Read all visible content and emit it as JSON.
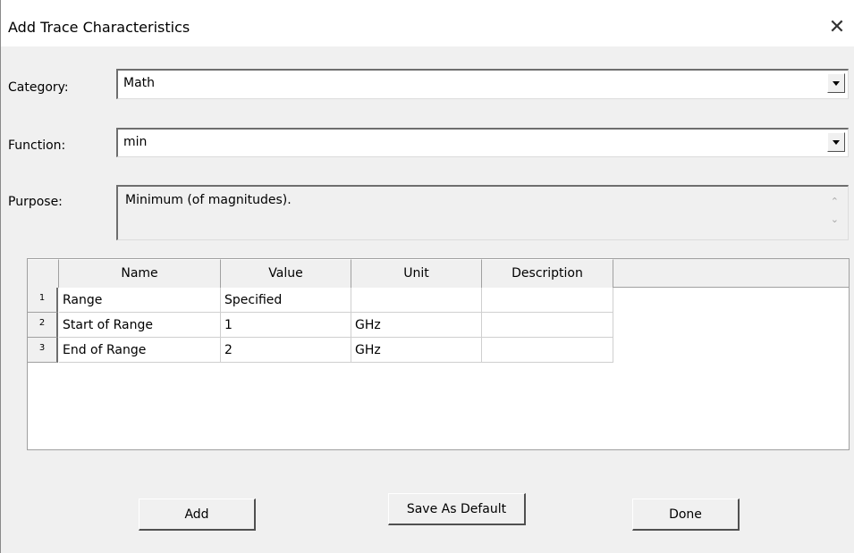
{
  "dialog": {
    "title": "Add Trace Characteristics",
    "close_glyph": "✕"
  },
  "category": {
    "label": "Category:",
    "value": "Math"
  },
  "function": {
    "label": "Function:",
    "value": "min"
  },
  "purpose": {
    "label": "Purpose:",
    "value": "Minimum (of magnitudes).",
    "scroll_up": "⌃",
    "scroll_down": "⌄"
  },
  "table": {
    "columns": [
      "Name",
      "Value",
      "Unit",
      "Description"
    ],
    "rows": [
      {
        "index": "1",
        "name": "Range",
        "value": "Specified",
        "unit": "",
        "description": ""
      },
      {
        "index": "2",
        "name": "Start of Range",
        "value": "1",
        "unit": "GHz",
        "description": ""
      },
      {
        "index": "3",
        "name": "End of Range",
        "value": "2",
        "unit": "GHz",
        "description": ""
      }
    ]
  },
  "buttons": {
    "add": "Add",
    "save_default": "Save As Default",
    "done": "Done"
  }
}
